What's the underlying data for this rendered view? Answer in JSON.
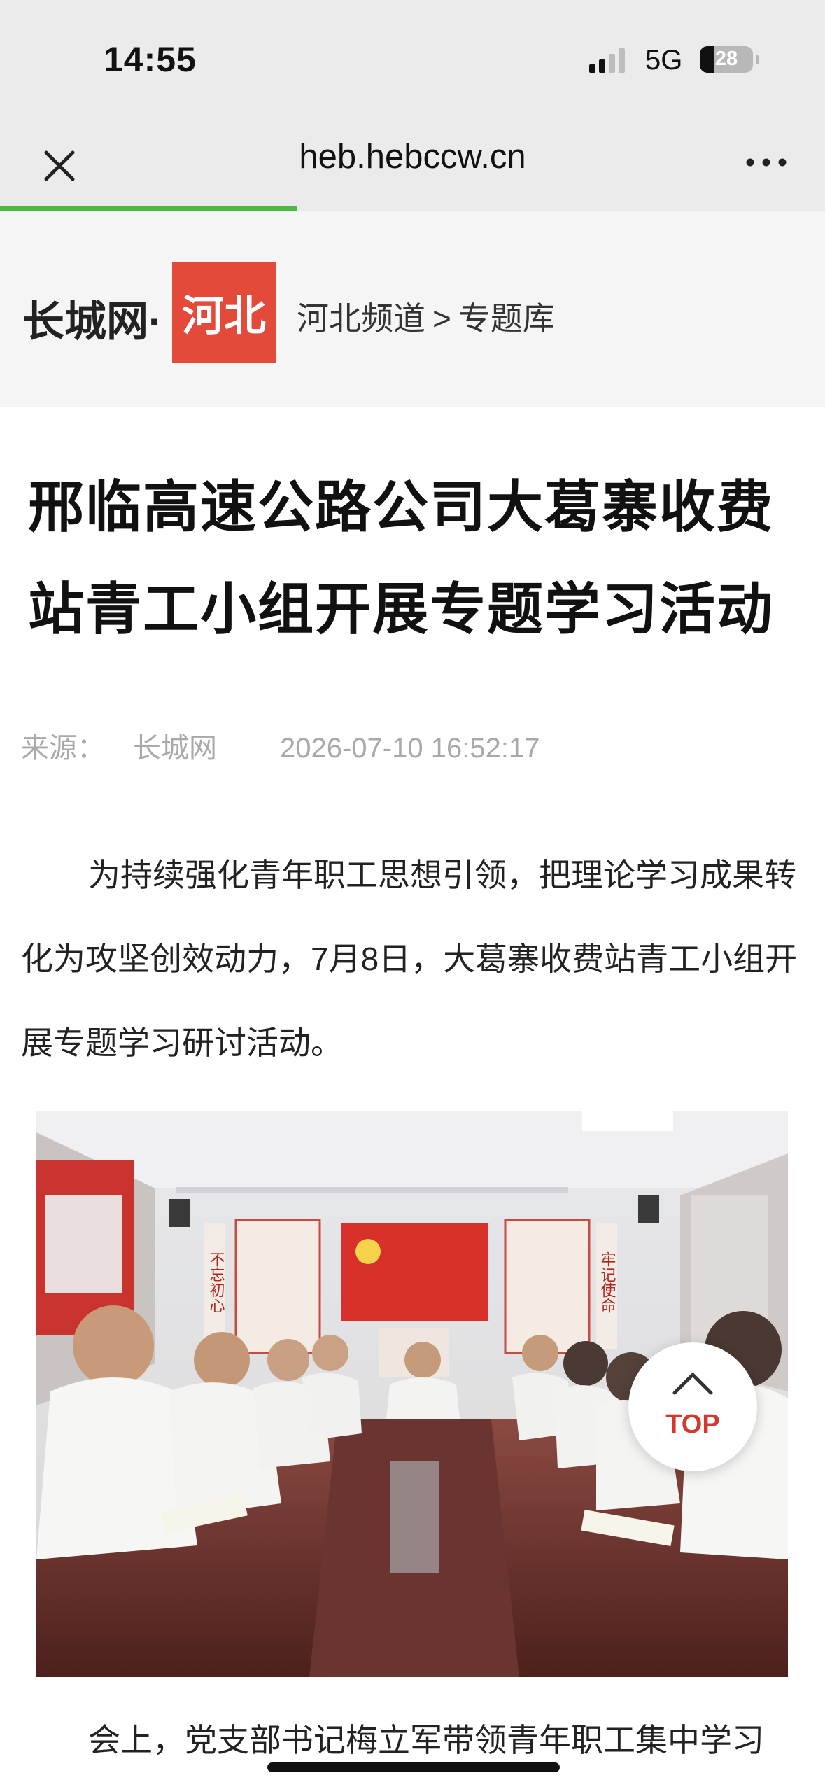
{
  "status_bar": {
    "time": "14:55",
    "network": "5G",
    "battery": "28",
    "battery_level": 0.28
  },
  "browser": {
    "url": "heb.hebccw.cn",
    "close_icon": "close-icon",
    "more_icon": "more-icon",
    "load_progress": 0.36,
    "progress_color": "#4fb843"
  },
  "site": {
    "name": "长城网·",
    "region": "河北",
    "region_color": "#e34a3a",
    "breadcrumb": [
      "河北频道",
      ">",
      "专题库"
    ]
  },
  "article": {
    "title": "邢临高速公路公司大葛寨收费站青工小组开展专题学习活动",
    "source_label": "来源：",
    "source": "长城网",
    "date": "2026-07-10 16:52:17",
    "paragraph1": "为持续强化青年职工思想引领，把理论学习成果转化为攻坚创效动力，7月8日，大葛寨收费站青工小组开展专题学习研讨活动。",
    "paragraph2": "会上，党支部书记梅立军带领青年职工集中学习"
  },
  "photo_banners": {
    "left": "不忘初心",
    "right": "牢记使命"
  },
  "top_button": {
    "label": "TOP",
    "color": "#d6372d"
  }
}
